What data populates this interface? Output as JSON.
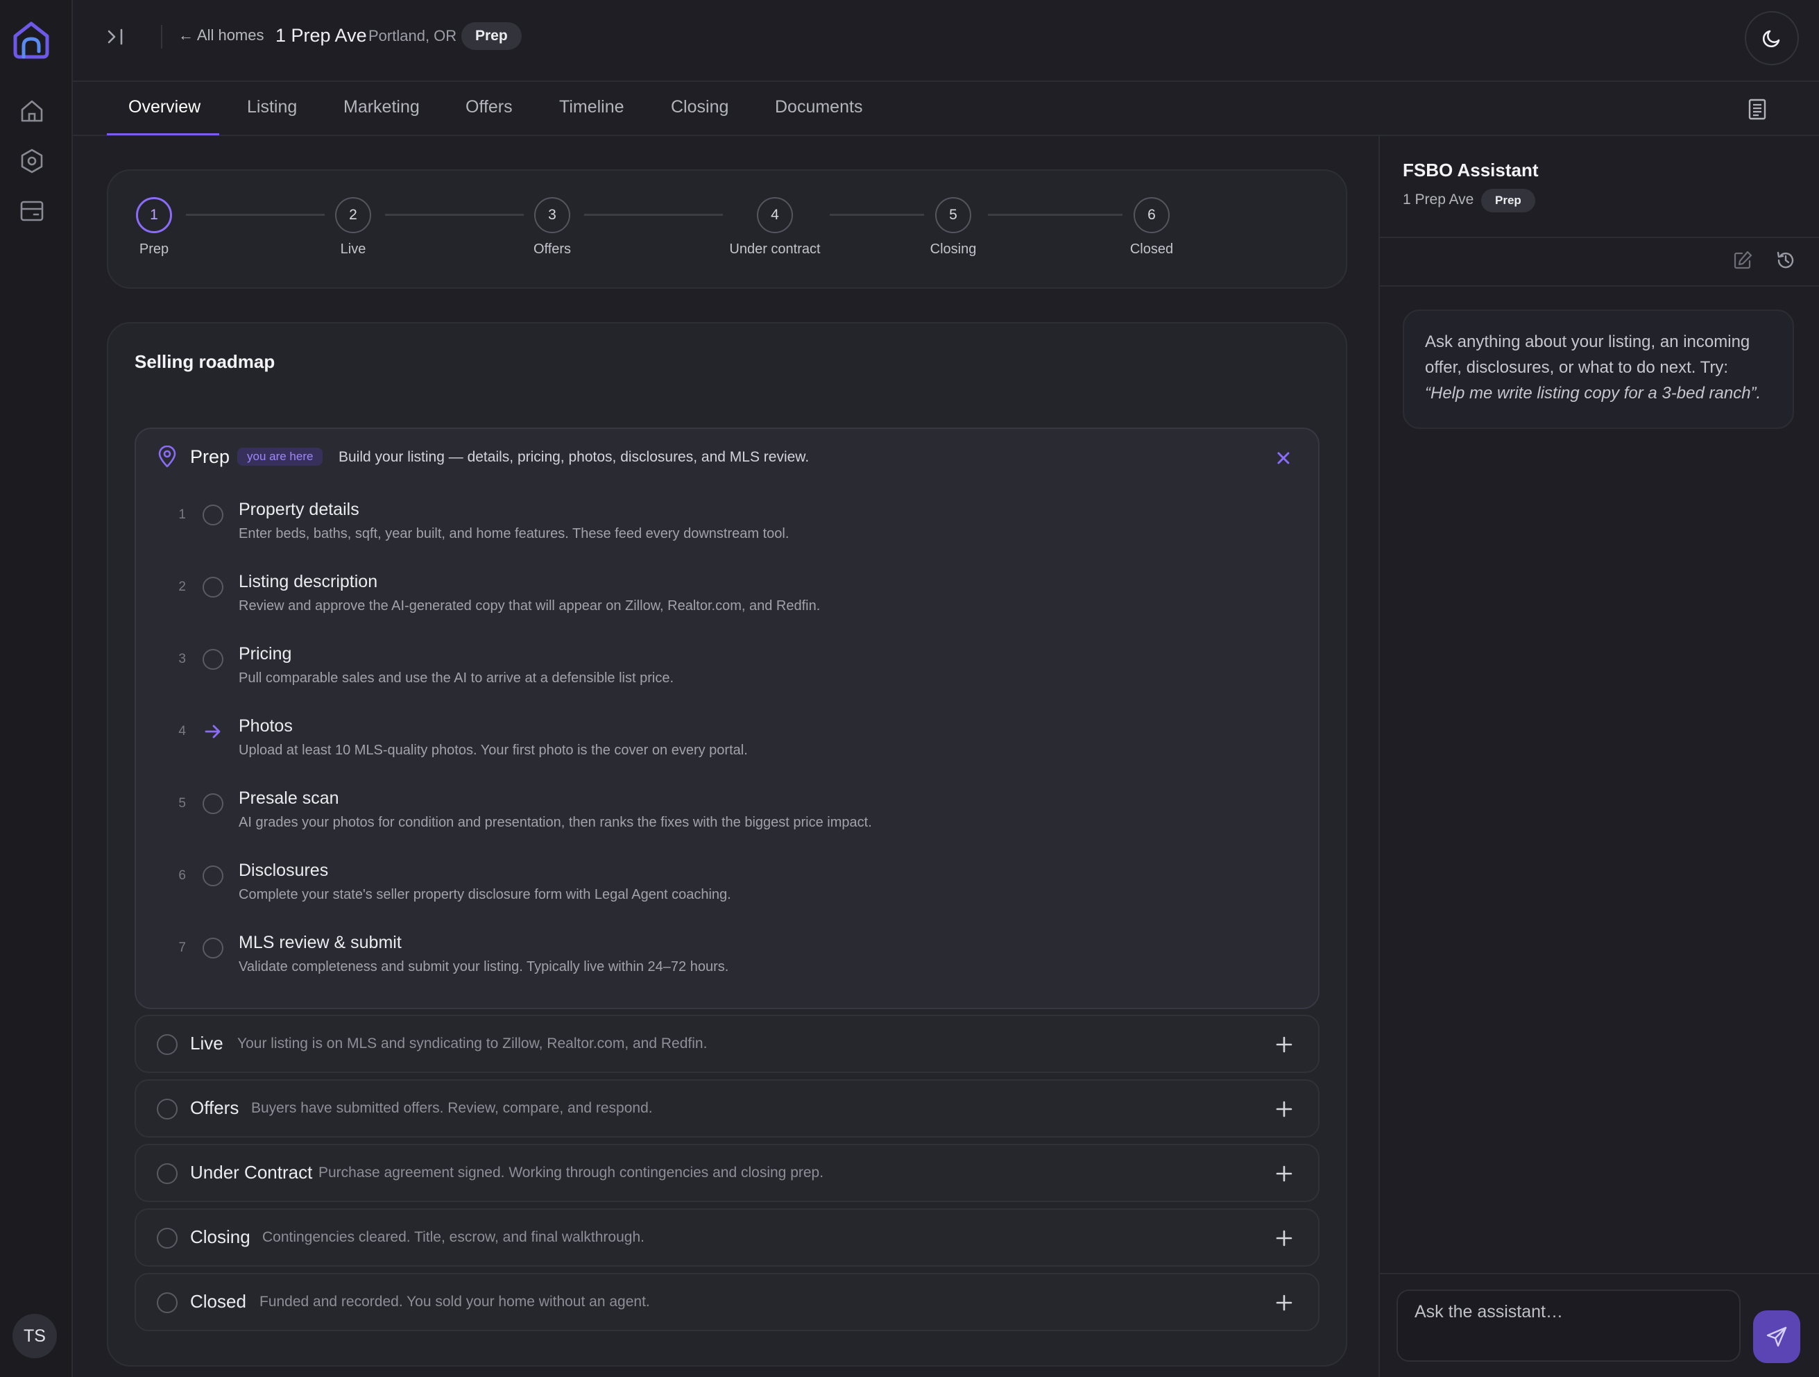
{
  "app": {
    "user_initials": "TS"
  },
  "header": {
    "back_link": "← All homes",
    "home_title": "1 Prep Ave",
    "home_city": "Portland, OR",
    "stage_badge": "Prep"
  },
  "tabs": [
    {
      "label": "Overview",
      "active": true
    },
    {
      "label": "Listing"
    },
    {
      "label": "Marketing"
    },
    {
      "label": "Offers"
    },
    {
      "label": "Timeline"
    },
    {
      "label": "Closing"
    },
    {
      "label": "Documents"
    }
  ],
  "stepper": [
    {
      "num": "1",
      "label": "Prep",
      "current": true
    },
    {
      "num": "2",
      "label": "Live"
    },
    {
      "num": "3",
      "label": "Offers"
    },
    {
      "num": "4",
      "label": "Under contract"
    },
    {
      "num": "5",
      "label": "Closing"
    },
    {
      "num": "6",
      "label": "Closed"
    }
  ],
  "roadmap": {
    "title": "Selling roadmap",
    "current_stage": {
      "name": "Prep",
      "marker": "you are here",
      "description": "Build your listing — details, pricing, photos, disclosures, and MLS review.",
      "tasks": [
        {
          "num": "1",
          "title": "Property details",
          "desc": "Enter beds, baths, sqft, year built, and home features. These feed every downstream tool."
        },
        {
          "num": "2",
          "title": "Listing description",
          "desc": "Review and approve the AI-generated copy that will appear on Zillow, Realtor.com, and Redfin."
        },
        {
          "num": "3",
          "title": "Pricing",
          "desc": "Pull comparable sales and use the AI to arrive at a defensible list price."
        },
        {
          "num": "4",
          "title": "Photos",
          "desc": "Upload at least 10 MLS-quality photos. Your first photo is the cover on every portal.",
          "next": true
        },
        {
          "num": "5",
          "title": "Presale scan",
          "desc": "AI grades your photos for condition and presentation, then ranks the fixes with the biggest price impact."
        },
        {
          "num": "6",
          "title": "Disclosures",
          "desc": "Complete your state's seller property disclosure form with Legal Agent coaching."
        },
        {
          "num": "7",
          "title": "MLS review & submit",
          "desc": "Validate completeness and submit your listing. Typically live within 24–72 hours."
        }
      ]
    },
    "stages": [
      {
        "name": "Live",
        "desc": "Your listing is on MLS and syndicating to Zillow, Realtor.com, and Redfin."
      },
      {
        "name": "Offers",
        "desc": "Buyers have submitted offers. Review, compare, and respond."
      },
      {
        "name": "Under Contract",
        "desc": "Purchase agreement signed. Working through contingencies and closing prep."
      },
      {
        "name": "Closing",
        "desc": "Contingencies cleared. Title, escrow, and final walkthrough."
      },
      {
        "name": "Closed",
        "desc": "Funded and recorded. You sold your home without an agent."
      }
    ]
  },
  "assistant": {
    "title": "FSBO Assistant",
    "home": "1 Prep Ave",
    "badge": "Prep",
    "hint_text": "Ask anything about your listing, an incoming offer, disclosures, or what to do next. Try: ",
    "hint_example": "“Help me write listing copy for a 3-bed ranch”.",
    "input_placeholder": "Ask the assistant…"
  },
  "colors": {
    "accent": "#7c5cf0",
    "background": "#1f1f25",
    "card": "#24242b",
    "send_button": "#5b45b5"
  },
  "icons": {
    "logo": "house-logo-icon",
    "rail": [
      "home-icon",
      "hexagon-settings-icon",
      "inbox-icon"
    ],
    "collapse": "sidebar-expand-icon",
    "theme": "moon-icon",
    "documents": "clipboard-icon",
    "stage_marker": "map-pin-icon",
    "close": "close-icon",
    "expand": "plus-icon",
    "next_task": "arrow-right-icon",
    "assistant_tools": [
      "edit-icon",
      "history-icon"
    ],
    "send": "send-icon"
  }
}
